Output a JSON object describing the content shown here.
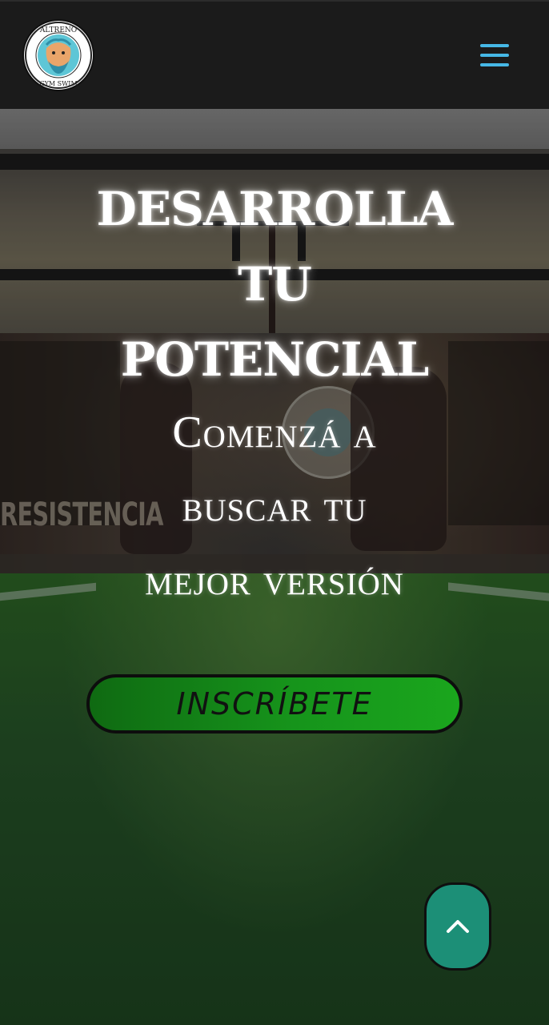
{
  "navbar": {
    "logo": {
      "ring_text_top": "ALTRENO",
      "ring_text_bottom": "GYM SWIM",
      "icon": "neptune-face-logo-icon"
    },
    "menu_icon": "hamburger-menu-icon",
    "accent_color": "#46b8e6"
  },
  "hero": {
    "headline": [
      "DESARROLLA",
      "TU",
      "POTENCIAL"
    ],
    "subheadline": [
      "Comenzá a",
      "buscar tu",
      "mejor versión"
    ],
    "background_mural_text": "RESISTENCIA",
    "cta": {
      "label": "INSCRÍBETE",
      "color": "#16941b"
    }
  },
  "scroll_top": {
    "icon": "chevron-up-icon",
    "color": "#1c8f77"
  }
}
